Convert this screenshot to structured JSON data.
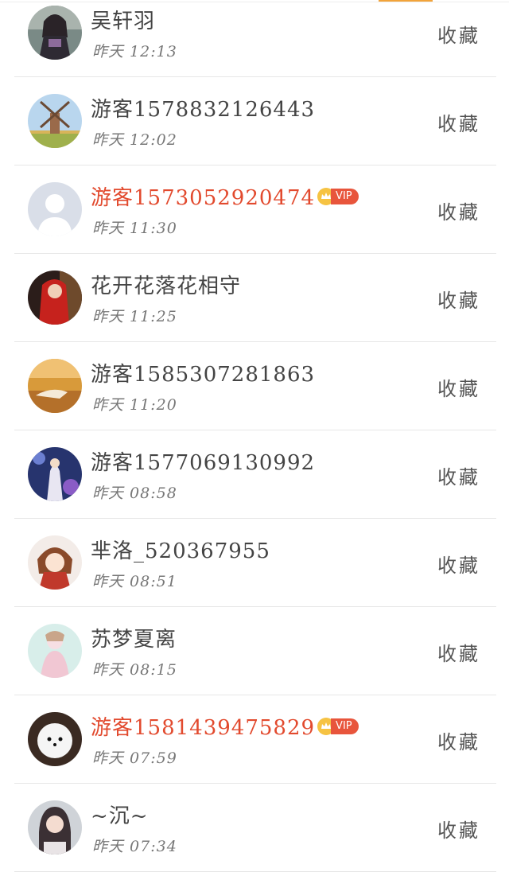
{
  "favorite_label": "收藏",
  "vip_label": "VIP",
  "items": [
    {
      "name": "吴轩羽",
      "time": "昨天 12:13",
      "vip": false,
      "avatar": "avatar-1"
    },
    {
      "name": "游客1578832126443",
      "time": "昨天 12:02",
      "vip": false,
      "avatar": "avatar-2"
    },
    {
      "name": "游客1573052920474",
      "time": "昨天 11:30",
      "vip": true,
      "avatar": "avatar-3"
    },
    {
      "name": "花开花落花相守",
      "time": "昨天 11:25",
      "vip": false,
      "avatar": "avatar-4"
    },
    {
      "name": "游客1585307281863",
      "time": "昨天 11:20",
      "vip": false,
      "avatar": "avatar-5"
    },
    {
      "name": "游客1577069130992",
      "time": "昨天 08:58",
      "vip": false,
      "avatar": "avatar-6"
    },
    {
      "name": "芈洛_520367955",
      "time": "昨天 08:51",
      "vip": false,
      "avatar": "avatar-7"
    },
    {
      "name": "苏梦夏离",
      "time": "昨天 08:15",
      "vip": false,
      "avatar": "avatar-8"
    },
    {
      "name": "游客1581439475829",
      "time": "昨天 07:59",
      "vip": true,
      "avatar": "avatar-9"
    },
    {
      "name": "~沉~",
      "time": "昨天 07:34",
      "vip": false,
      "avatar": "avatar-10"
    }
  ],
  "colors": {
    "vip_name": "#e24a2e",
    "normal_name": "#444444",
    "vip_badge": "#e8553c",
    "accent": "#f2a33a"
  }
}
